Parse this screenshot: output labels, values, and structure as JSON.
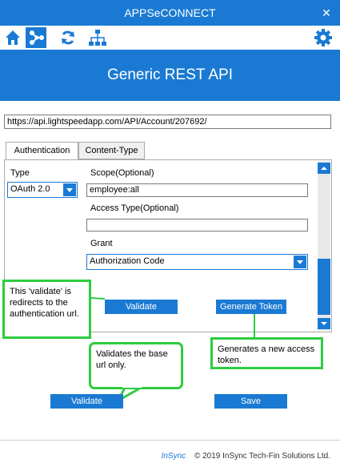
{
  "window": {
    "title": "APPSeCONNECT",
    "close_glyph": "✕"
  },
  "toolbar": {
    "items": [
      {
        "icon": "home-icon"
      },
      {
        "icon": "connections-icon",
        "active": true
      },
      {
        "icon": "sync-icon"
      },
      {
        "icon": "hierarchy-icon"
      }
    ],
    "settings_icon": "gear-icon"
  },
  "banner": {
    "title": "Generic REST API"
  },
  "url": {
    "value": "https://api.lightspeedapp.com/API/Account/207692/"
  },
  "tabs": [
    {
      "label": "Authentication",
      "selected": true
    },
    {
      "label": "Content-Type",
      "selected": false
    }
  ],
  "auth": {
    "type_label": "Type",
    "type_value": "OAuth 2.0",
    "scope_label": "Scope(Optional)",
    "scope_value": "employee:all",
    "access_type_label": "Access Type(Optional)",
    "access_type_value": "",
    "grant_label": "Grant",
    "grant_value": "Authorization Code",
    "validate_label": "Validate",
    "generate_token_label": "Generate Token"
  },
  "notes": {
    "validate_redirect": "This 'validate' is redirects to the authentication url.",
    "validate_base": "Validates the base url only.",
    "generate_token": "Generates a new access token."
  },
  "footer_buttons": {
    "validate_label": "Validate",
    "save_label": "Save"
  },
  "footer": {
    "brand": "InSync",
    "copyright": "©  2019 InSync Tech-Fin Solutions Ltd."
  },
  "colors": {
    "accent": "#1a7ad3",
    "annotation": "#2ecc40"
  }
}
